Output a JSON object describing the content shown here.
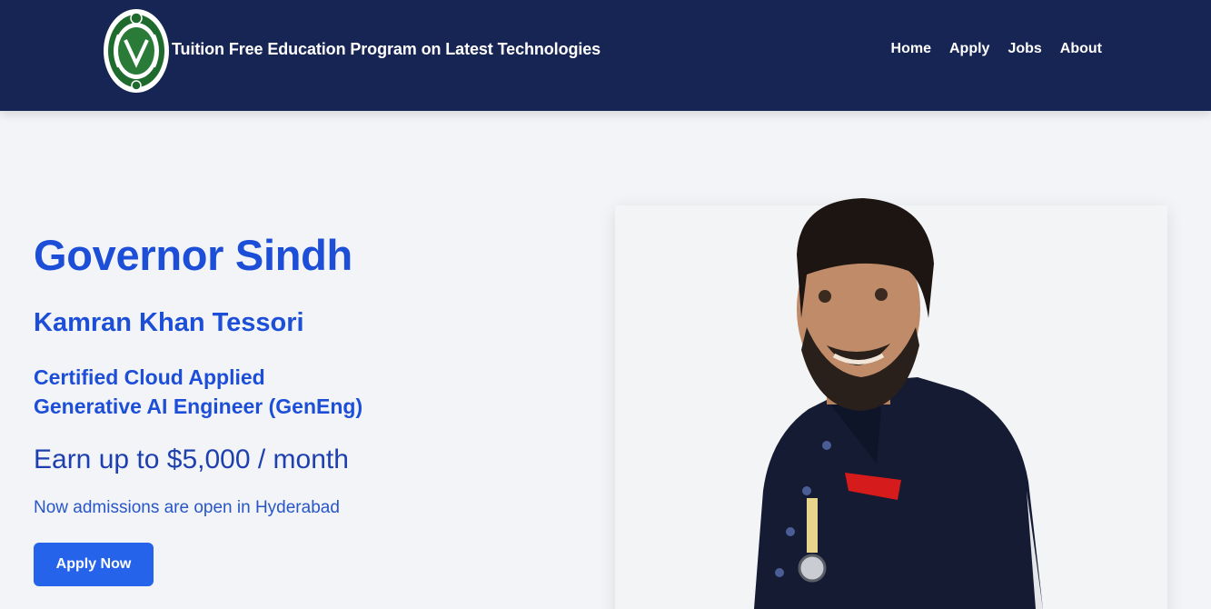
{
  "header": {
    "title": "Tuition Free Education Program on Latest Technologies",
    "logo_icon": "governor-house-emblem",
    "nav": [
      {
        "label": "Home"
      },
      {
        "label": "Apply"
      },
      {
        "label": "Jobs"
      },
      {
        "label": "About"
      }
    ]
  },
  "hero": {
    "title": "Governor Sindh",
    "name": "Kamran Khan Tessori",
    "certification_line1": "Certified Cloud Applied",
    "certification_line2": "Generative AI Engineer (GenEng)",
    "earnings": "Earn up to $5,000 / month",
    "admissions": "Now admissions are open in Hyderabad",
    "cta_label": "Apply Now",
    "portrait_icon": "governor-portrait"
  },
  "colors": {
    "navbar": "#172554",
    "accent": "#1d4ed8",
    "button": "#2563eb",
    "background": "#f2f4f7"
  }
}
